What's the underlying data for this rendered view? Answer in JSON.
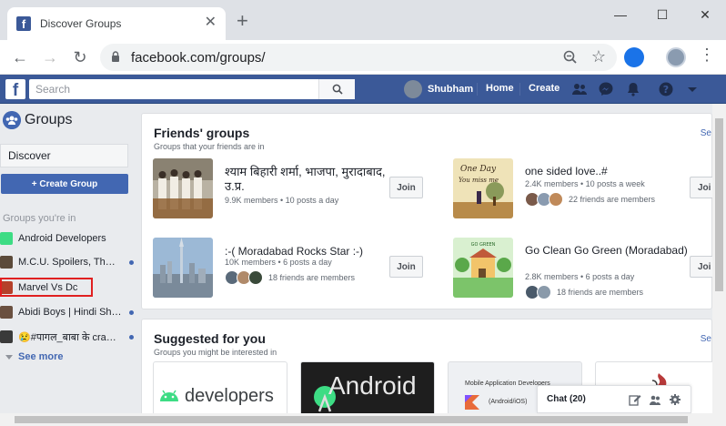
{
  "browser": {
    "tab_title": "Discover Groups",
    "url": "facebook.com/groups/",
    "win_minimize": "—",
    "win_restore": "☐",
    "win_close": "✕",
    "tab_close": "✕",
    "new_tab": "+",
    "back": "←",
    "forward": "→",
    "reload": "↻",
    "star": "☆",
    "menu": "⋮"
  },
  "fb": {
    "logo": "f",
    "search_placeholder": "Search",
    "user": "Shubham",
    "home": "Home",
    "create": "Create"
  },
  "sidebar": {
    "title": "Groups",
    "discover": "Discover",
    "create_button": "+ Create Group",
    "section_label": "Groups you're in",
    "groups": [
      {
        "label": "Android Developers",
        "color": "#3ddc84",
        "dot": false
      },
      {
        "label": "M.C.U. Spoilers, Th…",
        "color": "#5b4a3a",
        "dot": true
      },
      {
        "label": "Marvel Vs Dc",
        "color": "#b5402a",
        "dot": false
      },
      {
        "label": "Abidi Boys | Hindi Sh…",
        "color": "#6a5040",
        "dot": true
      },
      {
        "label": "😢#पागल_बाबा के cra…",
        "color": "#3a3a3a",
        "dot": true
      }
    ],
    "see_more": "See more"
  },
  "friends_groups": {
    "title": "Friends' groups",
    "subtitle": "Groups that your friends are in",
    "see_all": "Se",
    "join": "Join",
    "join_cut": "Joi",
    "items": [
      {
        "name": "श्याम बिहारी शर्मा, भाजपा, मुरादाबाद, उ.प्र.",
        "meta": "9.9K members • 10 posts a day",
        "friends": ""
      },
      {
        "name": "one sided love..#",
        "meta": "2.4K members • 10 posts a week",
        "friends": "22 friends are members"
      },
      {
        "name": ":-( Moradabad Rocks Star :-)",
        "meta": "10K members • 6 posts a day",
        "friends": "18 friends are members"
      },
      {
        "name": "Go Clean Go Green (Moradabad)",
        "meta": "2.8K members • 6 posts a day",
        "friends": "18 friends are members"
      }
    ]
  },
  "suggested": {
    "title": "Suggested for you",
    "subtitle": "Groups you might be interested in",
    "see_all": "Se",
    "items": [
      {
        "label": "developers"
      },
      {
        "label": "Android"
      },
      {
        "label": "Mobile Application Developers",
        "sub": "(Android/iOS)"
      },
      {
        "label": ""
      }
    ]
  },
  "chat": {
    "label": "Chat (20)"
  },
  "colors": {
    "fb_blue": "#3b5998",
    "button_blue": "#4267b2",
    "highlight_red": "#e02020"
  }
}
